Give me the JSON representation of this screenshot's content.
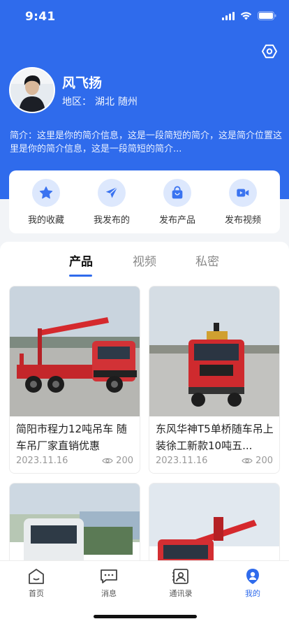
{
  "status": {
    "time": "9:41"
  },
  "profile": {
    "name": "风飞扬",
    "region_label": "地区：",
    "region_province": "湖北",
    "region_city": "随州",
    "bio": "简介：这里是你的简介信息，这是一段简短的简介，这是简介位置这里是你的简介信息，这是一段简短的简介..."
  },
  "quick_actions": [
    {
      "label": "我的收藏",
      "icon": "star-icon"
    },
    {
      "label": "我发布的",
      "icon": "send-icon"
    },
    {
      "label": "发布产品",
      "icon": "shopping-bag-icon"
    },
    {
      "label": "发布视频",
      "icon": "video-camera-icon"
    }
  ],
  "tabs": [
    {
      "label": "产品",
      "active": true
    },
    {
      "label": "视频",
      "active": false
    },
    {
      "label": "私密",
      "active": false
    }
  ],
  "products": [
    {
      "title": "简阳市程力12吨吊车 随车吊厂家直销优惠",
      "date": "2023.11.16",
      "views": "200"
    },
    {
      "title": "东风华神T5单桥随车吊上装徐工新款10吨五...",
      "date": "2023.11.16",
      "views": "200"
    },
    {
      "title": "",
      "date": "",
      "views": ""
    },
    {
      "title": "",
      "date": "",
      "views": ""
    }
  ],
  "bottom_nav": [
    {
      "label": "首页",
      "icon": "home-icon",
      "active": false
    },
    {
      "label": "消息",
      "icon": "message-icon",
      "active": false
    },
    {
      "label": "通讯录",
      "icon": "contacts-icon",
      "active": false
    },
    {
      "label": "我的",
      "icon": "profile-icon",
      "active": true
    }
  ],
  "colors": {
    "primary": "#2f6bec",
    "icon_bg": "#dde8fd",
    "truck_red": "#d8262b"
  }
}
